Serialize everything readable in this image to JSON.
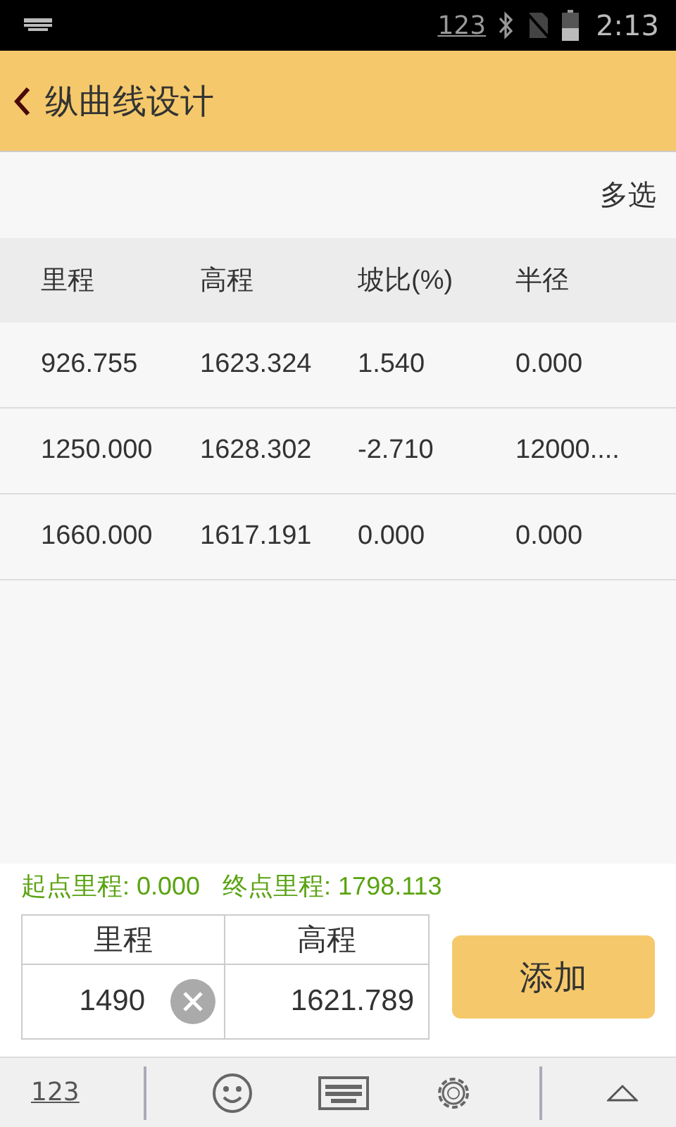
{
  "status_bar": {
    "input_mode": "123",
    "time": "2:13"
  },
  "app_bar": {
    "title": "纵曲线设计"
  },
  "toolbar": {
    "action": "多选"
  },
  "table": {
    "columns": [
      "里程",
      "高程",
      "坡比(%)",
      "半径"
    ],
    "rows": [
      [
        "926.755",
        "1623.324",
        "1.540",
        "0.000"
      ],
      [
        "1250.000",
        "1628.302",
        "-2.710",
        "12000...."
      ],
      [
        "1660.000",
        "1617.191",
        "0.000",
        "0.000"
      ]
    ]
  },
  "summary": {
    "start": "起点里程: 0.000",
    "end": "终点里程: 1798.113"
  },
  "entry": {
    "columns": [
      "里程",
      "高程"
    ],
    "mileage": "1490",
    "elevation": "1621.789",
    "add_button": "添加"
  },
  "keyboard_bar": {
    "mode_key": "123"
  }
}
